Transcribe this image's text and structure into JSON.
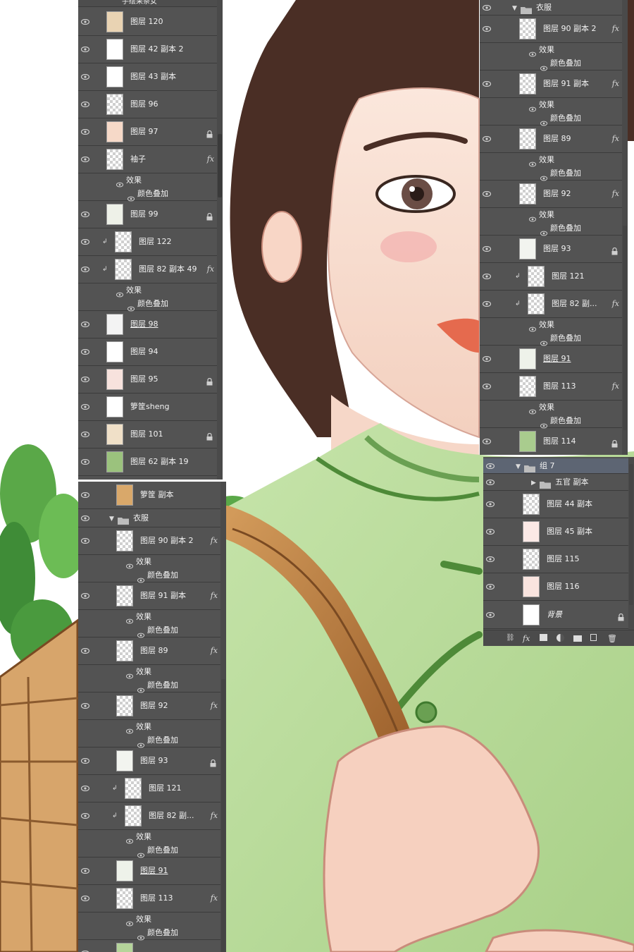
{
  "panel_left": {
    "header_text": "手绘采茶女",
    "layers": [
      {
        "name": "图层 120",
        "type": "layer",
        "thumb": "#e9d3b3"
      },
      {
        "name": "图层 42 副本 2",
        "type": "layer",
        "thumb": "#ffffff"
      },
      {
        "name": "图层 43 副本",
        "type": "layer",
        "thumb": "#ffffff"
      },
      {
        "name": "图层 96",
        "type": "layer",
        "thumb": "checker"
      },
      {
        "name": "图层 97",
        "type": "layer",
        "thumb": "#f6d9c8",
        "lock": true
      },
      {
        "name": "袖子",
        "type": "layer",
        "thumb": "checker",
        "fx": true
      },
      {
        "name": "效果",
        "type": "effect"
      },
      {
        "name": "颜色叠加",
        "type": "effect2"
      },
      {
        "name": "图层 99",
        "type": "layer",
        "thumb": "#eef1e8",
        "lock": true
      },
      {
        "name": "图层 122",
        "type": "layer",
        "thumb": "checker",
        "clip": true
      },
      {
        "name": "图层 82 副本 49",
        "type": "layer",
        "thumb": "checker",
        "clip": true,
        "fx": true
      },
      {
        "name": "效果",
        "type": "effect"
      },
      {
        "name": "颜色叠加",
        "type": "effect2"
      },
      {
        "name": "图层 98",
        "type": "layer",
        "thumb": "#f3f3f3",
        "underline": true
      },
      {
        "name": "图层 94",
        "type": "layer",
        "thumb": "#ffffff"
      },
      {
        "name": "图层 95",
        "type": "layer",
        "thumb": "#f7e2dd",
        "lock": true
      },
      {
        "name": "箩筐sheng",
        "type": "layer",
        "thumb": "#ffffff"
      },
      {
        "name": "图层 101",
        "type": "layer",
        "thumb": "#f0e0c8",
        "lock": true
      },
      {
        "name": "图层 62 副本 19",
        "type": "layer",
        "thumb": "#9bc27d"
      }
    ]
  },
  "panel_left2": {
    "layers": [
      {
        "name": "箩筐 副本",
        "type": "layer",
        "thumb": "#d9a86a"
      },
      {
        "name": "衣服",
        "type": "folder"
      },
      {
        "name": "图层 90 副本 2",
        "type": "layer",
        "thumb": "checker",
        "fx": true
      },
      {
        "name": "效果",
        "type": "effect"
      },
      {
        "name": "颜色叠加",
        "type": "effect2"
      },
      {
        "name": "图层 91 副本",
        "type": "layer",
        "thumb": "checker",
        "fx": true
      },
      {
        "name": "效果",
        "type": "effect"
      },
      {
        "name": "颜色叠加",
        "type": "effect2"
      },
      {
        "name": "图层 89",
        "type": "layer",
        "thumb": "checker",
        "fx": true
      },
      {
        "name": "效果",
        "type": "effect"
      },
      {
        "name": "颜色叠加",
        "type": "effect2"
      },
      {
        "name": "图层 92",
        "type": "layer",
        "thumb": "checker",
        "fx": true
      },
      {
        "name": "效果",
        "type": "effect"
      },
      {
        "name": "颜色叠加",
        "type": "effect2"
      },
      {
        "name": "图层 93",
        "type": "layer",
        "thumb": "#f2f4ef",
        "lock": true
      },
      {
        "name": "图层 121",
        "type": "layer",
        "thumb": "checker",
        "clip": true
      },
      {
        "name": "图层 82 副...",
        "type": "layer",
        "thumb": "checker",
        "clip": true,
        "fx": true
      },
      {
        "name": "效果",
        "type": "effect"
      },
      {
        "name": "颜色叠加",
        "type": "effect2"
      },
      {
        "name": "图层 91",
        "type": "layer",
        "thumb": "#eef2ea",
        "underline": true
      },
      {
        "name": "图层 113",
        "type": "layer",
        "thumb": "checker",
        "fx": true
      },
      {
        "name": "效果",
        "type": "effect"
      },
      {
        "name": "颜色叠加",
        "type": "effect2"
      },
      {
        "name": "",
        "type": "layer",
        "thumb": "#b5d49a"
      }
    ]
  },
  "panel_right": {
    "layers": [
      {
        "name": "衣服",
        "type": "folder"
      },
      {
        "name": "图层 90 副本 2",
        "type": "layer",
        "thumb": "checker",
        "fx": true
      },
      {
        "name": "效果",
        "type": "effect"
      },
      {
        "name": "颜色叠加",
        "type": "effect2"
      },
      {
        "name": "图层 91 副本",
        "type": "layer",
        "thumb": "checker",
        "fx": true
      },
      {
        "name": "效果",
        "type": "effect"
      },
      {
        "name": "颜色叠加",
        "type": "effect2"
      },
      {
        "name": "图层 89",
        "type": "layer",
        "thumb": "checker",
        "fx": true
      },
      {
        "name": "效果",
        "type": "effect"
      },
      {
        "name": "颜色叠加",
        "type": "effect2"
      },
      {
        "name": "图层 92",
        "type": "layer",
        "thumb": "checker",
        "fx": true
      },
      {
        "name": "效果",
        "type": "effect"
      },
      {
        "name": "颜色叠加",
        "type": "effect2"
      },
      {
        "name": "图层 93",
        "type": "layer",
        "thumb": "#f2f4ef",
        "lock": true
      },
      {
        "name": "图层 121",
        "type": "layer",
        "thumb": "checker",
        "clip": true
      },
      {
        "name": "图层 82 副...",
        "type": "layer",
        "thumb": "checker",
        "clip": true,
        "fx": true
      },
      {
        "name": "效果",
        "type": "effect"
      },
      {
        "name": "颜色叠加",
        "type": "effect2"
      },
      {
        "name": "图层 91",
        "type": "layer",
        "thumb": "#eef2ea",
        "underline": true
      },
      {
        "name": "图层 113",
        "type": "layer",
        "thumb": "checker",
        "fx": true
      },
      {
        "name": "效果",
        "type": "effect"
      },
      {
        "name": "颜色叠加",
        "type": "effect2"
      },
      {
        "name": "图层 114",
        "type": "layer",
        "thumb": "#a9cc8e",
        "lock": true
      }
    ]
  },
  "panel_right2": {
    "layers": [
      {
        "name": "组 7",
        "type": "group-open"
      },
      {
        "name": "五官 副本",
        "type": "group-closed"
      },
      {
        "name": "图层 44 副本",
        "type": "layer",
        "thumb": "checker"
      },
      {
        "name": "图层 45 副本",
        "type": "layer",
        "thumb": "#fbe9e6"
      },
      {
        "name": "图层 115",
        "type": "layer",
        "thumb": "checker"
      },
      {
        "name": "图层 116",
        "type": "layer",
        "thumb": "#f9e4df"
      },
      {
        "name": "背景",
        "type": "background",
        "thumb": "#ffffff",
        "lock": true
      }
    ]
  },
  "colors": {
    "panel_bg": "#535353",
    "dress_green": "#b9dc9c",
    "hair_brown": "#4a2e25",
    "skin": "#f7dccd",
    "basket_brown": "#c68a49",
    "leaf_green": "#4f9b3f"
  }
}
